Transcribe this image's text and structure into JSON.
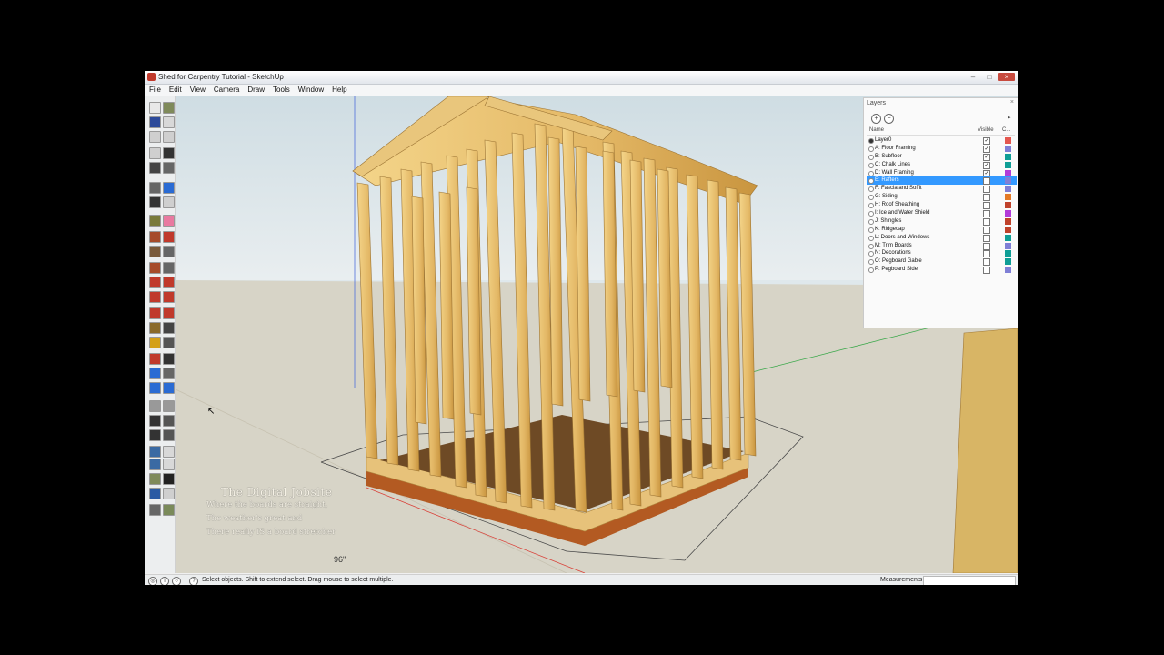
{
  "window": {
    "title": "Shed for Carpentry Tutorial - SketchUp",
    "minimize": "–",
    "maximize": "□",
    "close": "×"
  },
  "menu": [
    "File",
    "Edit",
    "View",
    "Camera",
    "Draw",
    "Tools",
    "Window",
    "Help"
  ],
  "toolbar": {
    "tools": [
      {
        "name": "rectangle-icon",
        "color": "#e8e8e8"
      },
      {
        "name": "get-models-icon",
        "color": "#7f8a5a"
      },
      {
        "name": "save-icon",
        "color": "#2c4a9a"
      },
      {
        "name": "print-icon",
        "color": "#d8d8d8"
      },
      {
        "name": "cut-icon",
        "color": "#cfcfcf"
      },
      {
        "name": "copy-icon",
        "color": "#cfcfcf"
      },
      {
        "name": "paste-icon",
        "color": "#cfcfcf"
      },
      {
        "name": "erase-icon",
        "color": "#333333"
      },
      {
        "name": "undo-icon",
        "color": "#444444"
      },
      {
        "name": "redo-icon",
        "color": "#666666"
      },
      {
        "name": "model-info-icon",
        "color": "#666666"
      },
      {
        "name": "info-icon",
        "color": "#2a6bd3"
      },
      {
        "name": "select-icon",
        "color": "#333333"
      },
      {
        "name": "make-component-icon",
        "color": "#cfcfcf"
      },
      {
        "name": "paint-bucket-icon",
        "color": "#7a7a3a"
      },
      {
        "name": "eraser-icon",
        "color": "#e97aa0"
      },
      {
        "name": "rectangle-draw-icon",
        "color": "#a64b2a"
      },
      {
        "name": "line-icon",
        "color": "#c0392b"
      },
      {
        "name": "circle-icon",
        "color": "#7a5a3a"
      },
      {
        "name": "arc-icon",
        "color": "#666666"
      },
      {
        "name": "polygon-icon",
        "color": "#a64b2a"
      },
      {
        "name": "freehand-icon",
        "color": "#666666"
      },
      {
        "name": "move-icon",
        "color": "#c0392b"
      },
      {
        "name": "push-pull-icon",
        "color": "#c0392b"
      },
      {
        "name": "rotate-icon",
        "color": "#c0392b"
      },
      {
        "name": "follow-me-icon",
        "color": "#c0392b"
      },
      {
        "name": "scale-icon",
        "color": "#c0392b"
      },
      {
        "name": "offset-icon",
        "color": "#c0392b"
      },
      {
        "name": "tape-measure-icon",
        "color": "#8a6a2a"
      },
      {
        "name": "dimension-icon",
        "color": "#444444"
      },
      {
        "name": "protractor-icon",
        "color": "#d4a017"
      },
      {
        "name": "text-icon",
        "color": "#555555"
      },
      {
        "name": "axes-icon",
        "color": "#c0392b"
      },
      {
        "name": "3d-text-icon",
        "color": "#333333"
      },
      {
        "name": "orbit-icon",
        "color": "#2a6bd3"
      },
      {
        "name": "pan-icon",
        "color": "#666666"
      },
      {
        "name": "zoom-icon",
        "color": "#2a6bd3"
      },
      {
        "name": "zoom-window-icon",
        "color": "#2a6bd3"
      },
      {
        "name": "zoom-extents-icon",
        "color": "#999999"
      },
      {
        "name": "previous-view-icon",
        "color": "#999999"
      },
      {
        "name": "walk-icon",
        "color": "#333333"
      },
      {
        "name": "look-around-icon",
        "color": "#555555"
      },
      {
        "name": "position-camera-icon",
        "color": "#333333"
      },
      {
        "name": "section-plane-icon",
        "color": "#555555"
      },
      {
        "name": "iso-view-icon",
        "color": "#3a6aa3"
      },
      {
        "name": "top-view-icon",
        "color": "#d8d8d8"
      },
      {
        "name": "front-view-icon",
        "color": "#3a6aa3"
      },
      {
        "name": "right-view-icon",
        "color": "#d8d8d8"
      },
      {
        "name": "back-view-icon",
        "color": "#7f8a5a"
      },
      {
        "name": "left-view-icon",
        "color": "#222222"
      },
      {
        "name": "xray-icon",
        "color": "#2a5aa3"
      },
      {
        "name": "wireframe-icon",
        "color": "#cfcfcf"
      },
      {
        "name": "hidden-line-icon",
        "color": "#666666"
      },
      {
        "name": "shaded-icon",
        "color": "#7a8a5a"
      }
    ]
  },
  "viewport": {
    "watermark": {
      "title": "The Digital Jobsite",
      "lines": [
        "Where the boards are straight,",
        "The weather's great and",
        "There really IS a board stretcher"
      ]
    },
    "dimension": "96\""
  },
  "layers": {
    "title": "Layers",
    "add": "+",
    "remove": "−",
    "details": "▸",
    "close_label": "×",
    "columns": {
      "name": "Name",
      "visible": "Visible",
      "color": "C..."
    },
    "items": [
      {
        "name": "Layer0",
        "visible": true,
        "color": "#e4574f",
        "active": true
      },
      {
        "name": "A: Floor Framing",
        "visible": true,
        "color": "#7f7fd6"
      },
      {
        "name": "B: Subfloor",
        "visible": true,
        "color": "#0f9e96"
      },
      {
        "name": "C: Chalk Lines",
        "visible": true,
        "color": "#0f9e96"
      },
      {
        "name": "D: Wall Framing",
        "visible": true,
        "color": "#b23bd9"
      },
      {
        "name": "E: Rafters",
        "visible": false,
        "color": "#7f7fd6",
        "selected": true
      },
      {
        "name": "F: Fascia and Soffit",
        "visible": false,
        "color": "#7f7fd6"
      },
      {
        "name": "G: Siding",
        "visible": false,
        "color": "#e47a27"
      },
      {
        "name": "H: Roof Sheathing",
        "visible": false,
        "color": "#c0422b"
      },
      {
        "name": "I: Ice and Water Shield",
        "visible": false,
        "color": "#b23bd9"
      },
      {
        "name": "J: Shingles",
        "visible": false,
        "color": "#c0422b"
      },
      {
        "name": "K: Ridgecap",
        "visible": false,
        "color": "#c0422b"
      },
      {
        "name": "L: Doors and Windows",
        "visible": false,
        "color": "#0f9e96"
      },
      {
        "name": "M: Trim Boards",
        "visible": false,
        "color": "#7f7fd6"
      },
      {
        "name": "N: Decorations",
        "visible": false,
        "color": "#0f9e96"
      },
      {
        "name": "O: Pegboard Gable",
        "visible": false,
        "color": "#0f9e96"
      },
      {
        "name": "P: Pegboard Side",
        "visible": false,
        "color": "#7f7fd6"
      }
    ]
  },
  "status": {
    "text": "Select objects. Shift to extend select. Drag mouse to select multiple.",
    "icons": [
      "geo-location-icon",
      "credits-icon",
      "help-icon"
    ],
    "measurements_label": "Measurements",
    "measurements_value": ""
  }
}
